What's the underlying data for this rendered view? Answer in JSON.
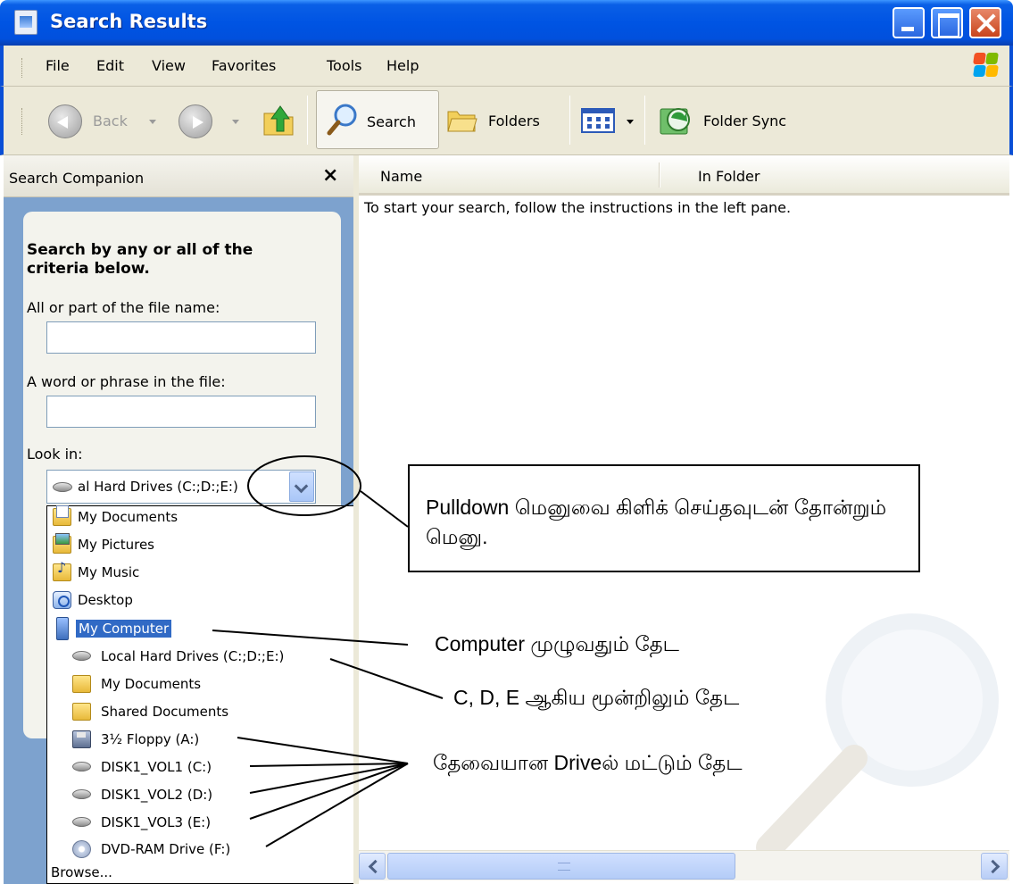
{
  "window": {
    "title": "Search Results",
    "buttons": [
      "minimize",
      "maximize",
      "close"
    ]
  },
  "menu": [
    "File",
    "Edit",
    "View",
    "Favorites",
    "Tools",
    "Help"
  ],
  "toolbar": {
    "back_label": "Back",
    "search_label": "Search",
    "folders_label": "Folders",
    "folder_sync_label": "Folder Sync"
  },
  "left_pane": {
    "title": "Search Companion",
    "close_glyph": "×",
    "heading": "Search by any or all of the criteria below.",
    "file_name_label": "All or part of the file name:",
    "file_name_value": "",
    "phrase_label": "A word or phrase in the file:",
    "phrase_value": "",
    "look_in_label": "Look in:",
    "look_in_value": "al Hard Drives (C:;D:;E:)"
  },
  "dropdown": {
    "items": [
      {
        "label": "My Documents",
        "icon": "my-documents-icon"
      },
      {
        "label": "My Pictures",
        "icon": "my-pictures-icon"
      },
      {
        "label": "My Music",
        "icon": "my-music-icon"
      },
      {
        "label": "Desktop",
        "icon": "desktop-icon"
      },
      {
        "label": "My Computer",
        "icon": "my-computer-icon",
        "selected": true
      },
      {
        "label": "Local Hard Drives (C:;D:;E:)",
        "icon": "hard-drive-icon"
      },
      {
        "label": "My Documents",
        "icon": "folder-icon"
      },
      {
        "label": "Shared Documents",
        "icon": "folder-icon"
      },
      {
        "label": "3½ Floppy (A:)",
        "icon": "floppy-icon"
      },
      {
        "label": "DISK1_VOL1 (C:)",
        "icon": "hard-drive-icon"
      },
      {
        "label": "DISK1_VOL2 (D:)",
        "icon": "hard-drive-icon"
      },
      {
        "label": "DISK1_VOL3 (E:)",
        "icon": "hard-drive-icon"
      },
      {
        "label": "DVD-RAM Drive (F:)",
        "icon": "dvd-icon"
      },
      {
        "label": "Browse...",
        "icon": ""
      }
    ]
  },
  "results": {
    "col_name": "Name",
    "col_in_folder": "In Folder",
    "message": "To start your search, follow the instructions in the left pane."
  },
  "annotations": {
    "callout": "Pulldown மெனுவை கிளிக் செய்தவுடன் தோன்றும் மெனு.",
    "computer": "Computer முழுவதும் தேட",
    "cde": "C, D, E ஆகிய மூன்றிலும் தேட",
    "drive": "தேவையான Driveல் மட்டும் தேட"
  },
  "colors": {
    "titlebar": "#0054e3",
    "chrome": "#ece9d8",
    "pane_blue": "#7da2ce",
    "selection": "#316ac5"
  }
}
